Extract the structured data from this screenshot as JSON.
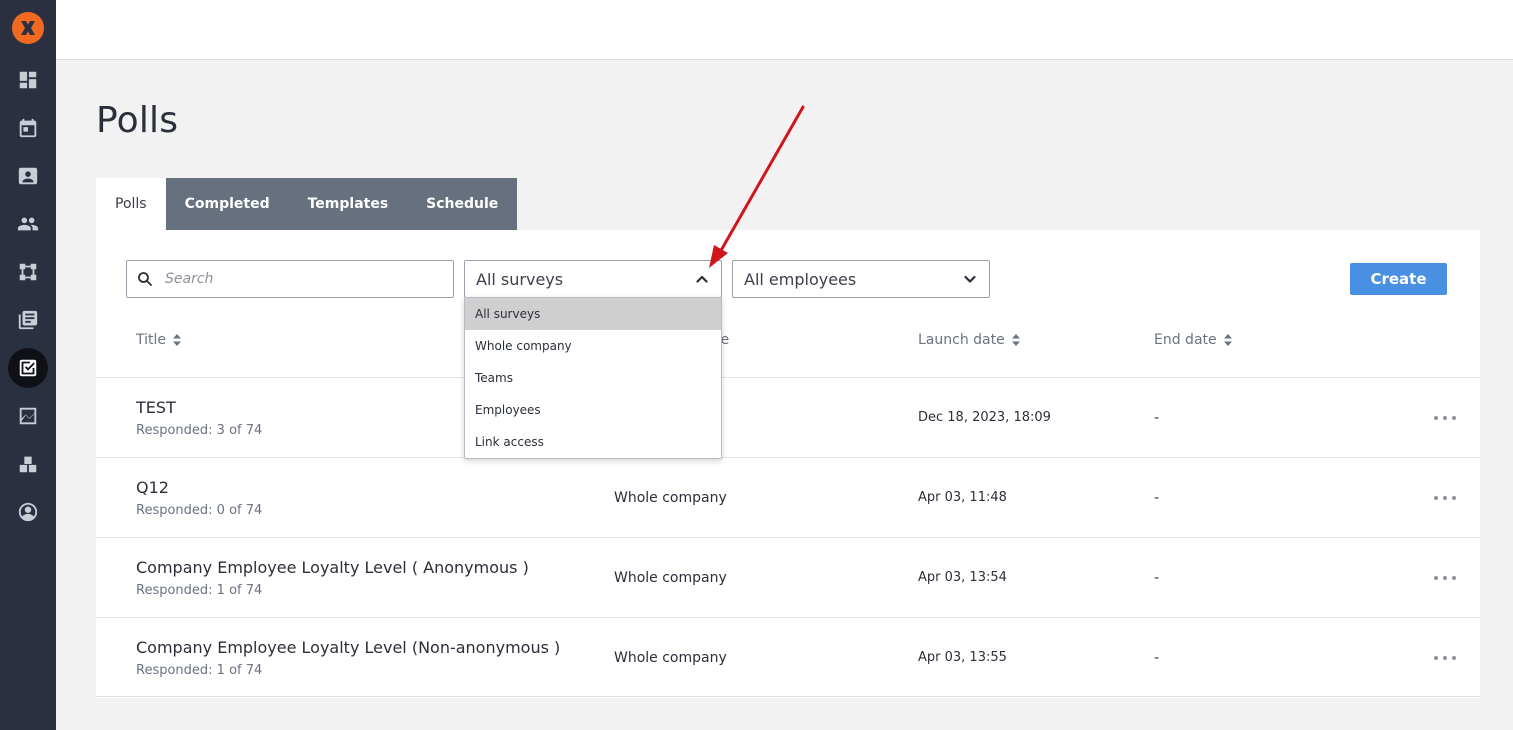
{
  "sidebar": {
    "items": [
      {
        "icon": "dashboard-icon"
      },
      {
        "icon": "calendar-icon"
      },
      {
        "icon": "contact-card-icon"
      },
      {
        "icon": "people-icon"
      },
      {
        "icon": "org-chart-icon"
      },
      {
        "icon": "library-icon"
      },
      {
        "icon": "poll-checkbox-icon",
        "active": true
      },
      {
        "icon": "trend-chart-icon"
      },
      {
        "icon": "blocks-icon"
      },
      {
        "icon": "account-circle-icon"
      }
    ]
  },
  "page": {
    "title": "Polls"
  },
  "tabs": [
    {
      "label": "Polls",
      "active": true
    },
    {
      "label": "Completed"
    },
    {
      "label": "Templates"
    },
    {
      "label": "Schedule"
    }
  ],
  "filters": {
    "search_placeholder": "Search",
    "survey_select_value": "All surveys",
    "employee_select_value": "All employees",
    "create_label": "Create"
  },
  "columns": {
    "title": "Title",
    "audience_partial": "nce",
    "launch": "Launch date",
    "end": "End date"
  },
  "rows": [
    {
      "title": "TEST",
      "responded": "Responded: 3 of 74",
      "audience": "",
      "launch": "Dec 18, 2023, 18:09",
      "end": "-"
    },
    {
      "title": "Q12",
      "responded": "Responded: 0 of 74",
      "audience": "Whole company",
      "launch": "Apr 03, 11:48",
      "end": "-"
    },
    {
      "title": "Company Employee Loyalty Level ( Anonymous )",
      "responded": "Responded: 1 of 74",
      "audience": "Whole company",
      "launch": "Apr 03, 13:54",
      "end": "-"
    },
    {
      "title": "Company Employee Loyalty Level (Non-anonymous )",
      "responded": "Responded: 1 of 74",
      "audience": "Whole company",
      "launch": "Apr 03, 13:55",
      "end": "-"
    }
  ],
  "dropdown": {
    "options": [
      {
        "label": "All surveys",
        "selected": true
      },
      {
        "label": "Whole company"
      },
      {
        "label": "Teams"
      },
      {
        "label": "Employees"
      },
      {
        "label": "Link access"
      }
    ]
  },
  "colors": {
    "sidebar": "#2b3040",
    "brand": "#f26a21",
    "primary_button": "#4a90e2",
    "tab_inactive": "#66707f",
    "annotation_arrow": "#d0161c"
  }
}
